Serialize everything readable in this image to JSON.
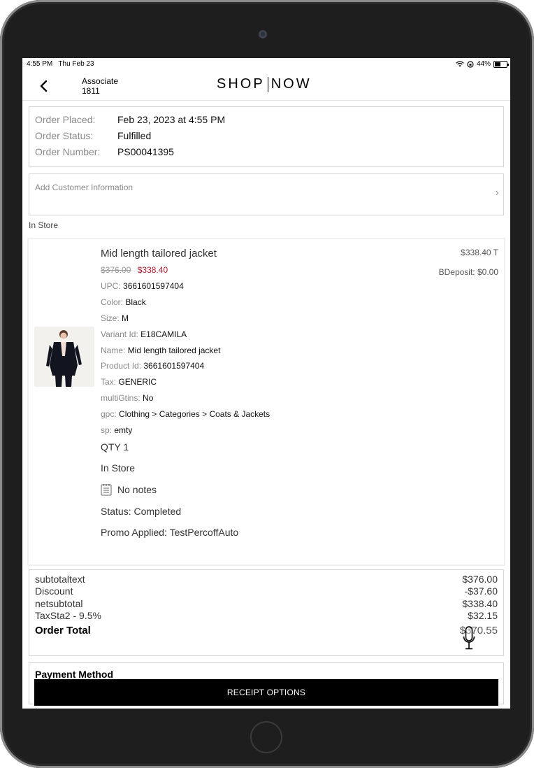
{
  "status_bar": {
    "time": "4:55 PM",
    "date": "Thu Feb 23",
    "battery": "44%"
  },
  "header": {
    "associate_label": "Associate",
    "associate_id": "1811",
    "logo_left": "SHOP",
    "logo_right": "NOW"
  },
  "order": {
    "placed_label": "Order Placed:",
    "placed_value": "Feb 23, 2023 at 4:55 PM",
    "status_label": "Order Status:",
    "status_value": "Fulfilled",
    "number_label": "Order Number:",
    "number_value": "PS00041395"
  },
  "customer": {
    "add_label": "Add Customer Information"
  },
  "fulfillment_label": "In Store",
  "item": {
    "title": "Mid length tailored jacket",
    "original_price": "$376.00",
    "sale_price": "$338.40",
    "line_total": "$338.40 T",
    "deposit": "BDeposit: $0.00",
    "attributes": [
      {
        "key": "UPC:",
        "value": "3661601597404"
      },
      {
        "key": "Color:",
        "value": "Black"
      },
      {
        "key": "Size:",
        "value": "M"
      },
      {
        "key": "Variant Id:",
        "value": "E18CAMILA"
      },
      {
        "key": "Name:",
        "value": "Mid length tailored jacket"
      },
      {
        "key": "Product Id:",
        "value": "3661601597404"
      },
      {
        "key": "Tax:",
        "value": "GENERIC"
      },
      {
        "key": "multiGtins:",
        "value": "No"
      },
      {
        "key": "gpc:",
        "value": "Clothing > Categories > Coats & Jackets"
      },
      {
        "key": "sp:",
        "value": "emty"
      }
    ],
    "qty": "QTY 1",
    "fulfillment": "In Store",
    "notes": "No notes",
    "status": "Status: Completed",
    "promo": "Promo Applied: TestPercoffAuto"
  },
  "totals": {
    "rows": [
      {
        "label": "subtotaltext",
        "amount": "$376.00"
      },
      {
        "label": "Discount",
        "amount": "-$37.60"
      },
      {
        "label": "netsubtotal",
        "amount": "$338.40"
      },
      {
        "label": "TaxSta2 - 9.5%",
        "amount": "$32.15"
      }
    ],
    "total_label": "Order Total",
    "total_amount": "$370.55"
  },
  "payment": {
    "title": "Payment Method"
  },
  "receipt_button": "RECEIPT OPTIONS"
}
